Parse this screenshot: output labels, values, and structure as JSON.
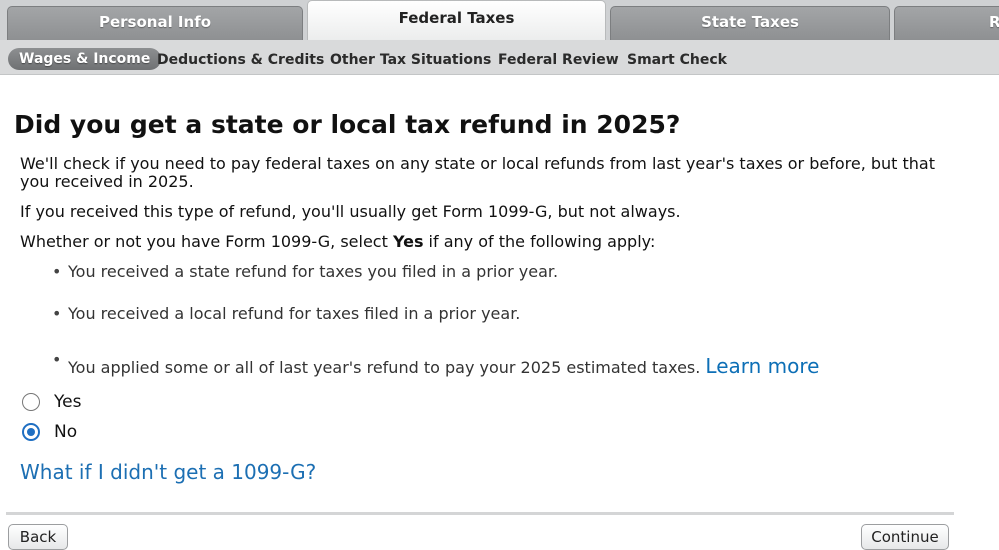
{
  "tabs": {
    "personal_info": "Personal Info",
    "federal_taxes": "Federal Taxes",
    "state_taxes": "State Taxes",
    "partial": "R"
  },
  "subnav": {
    "wages_income": "Wages & Income",
    "deductions_credits": "Deductions & Credits",
    "other_tax": "Other Tax Situations",
    "federal_review": "Federal Review",
    "smart_check": "Smart Check"
  },
  "page": {
    "title": "Did you get a state or local tax refund in 2025?",
    "intro": "We'll check if you need to pay federal taxes on any state or local refunds from last year's taxes or before, but that you received in 2025.",
    "usually": "If you received this type of refund, you'll usually get Form 1099-G, but not always.",
    "apply_prefix": "Whether or not you have Form 1099-G, select ",
    "apply_bold": "Yes",
    "apply_suffix": " if any of the following apply:",
    "bullets": [
      "You received a state refund for taxes you filed in a prior year.",
      "You received a local refund for taxes filed in a prior year.",
      "You applied some or all of last year's refund to pay your 2025 estimated taxes."
    ],
    "learn_more": "Learn more",
    "options": {
      "yes": "Yes",
      "no": "No",
      "selected": "No"
    },
    "help_link": "What if I didn't get a 1099-G?"
  },
  "footer": {
    "back": "Back",
    "continue": "Continue"
  },
  "colors": {
    "link": "#1c6fb3",
    "radio_selected": "#1f6fc2"
  }
}
